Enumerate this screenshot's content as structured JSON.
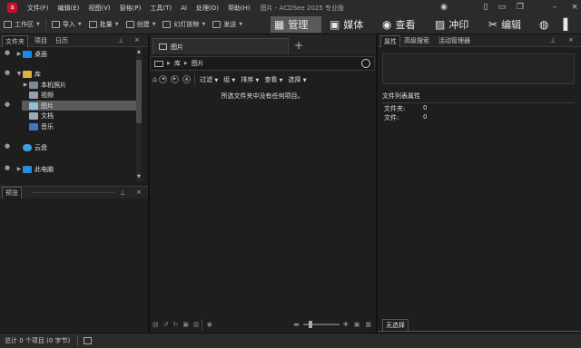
{
  "app": {
    "logo": "a",
    "title": "图片 - ACDSee 2025 专业版"
  },
  "menu": [
    "文件(F)",
    "编辑(E)",
    "视图(V)",
    "窗格(P)",
    "工具(T)",
    "AI",
    "处理(O)",
    "帮助(H)"
  ],
  "toolbar": {
    "workspace": "工作区",
    "import": "导入",
    "batch": "批量",
    "create": "创建",
    "slideshow": "幻灯放映",
    "send": "发送"
  },
  "modes": {
    "manage": "管理",
    "media": "媒体",
    "view": "查看",
    "develop": "冲印",
    "edit": "编辑"
  },
  "left_panel": {
    "tabs": [
      "文件夹",
      "项目",
      "日历"
    ],
    "tree": {
      "desktop": "桌面",
      "library": "库",
      "this_pc_pics": "本机照片",
      "video": "视频",
      "pictures": "图片",
      "documents": "文档",
      "music": "音乐",
      "cloud": "云盘",
      "this_pc": "此电脑"
    }
  },
  "preview": {
    "tab": "预览"
  },
  "center": {
    "tab": "图片",
    "breadcrumb": [
      "库",
      "图片"
    ],
    "filter_bar": {
      "filter": "过滤",
      "group": "组",
      "sort": "排序",
      "view": "查看",
      "select": "选择"
    },
    "empty_message": "所选文件夹中没有任何项目。"
  },
  "right_panel": {
    "tabs": [
      "属性",
      "高级搜索",
      "活动管理器"
    ],
    "file_list_header": "文件列表属性",
    "rows": [
      {
        "label": "文件夹:",
        "value": "0"
      },
      {
        "label": "文件:",
        "value": "0"
      }
    ],
    "bottom_tab": "无选择"
  },
  "status": {
    "text": "总计 0 个项目 (0 字节)"
  },
  "colors": {
    "accent_selected": "#5a5a5a",
    "logo_red": "#c8102e",
    "folder_blue": "#1e88e5"
  }
}
